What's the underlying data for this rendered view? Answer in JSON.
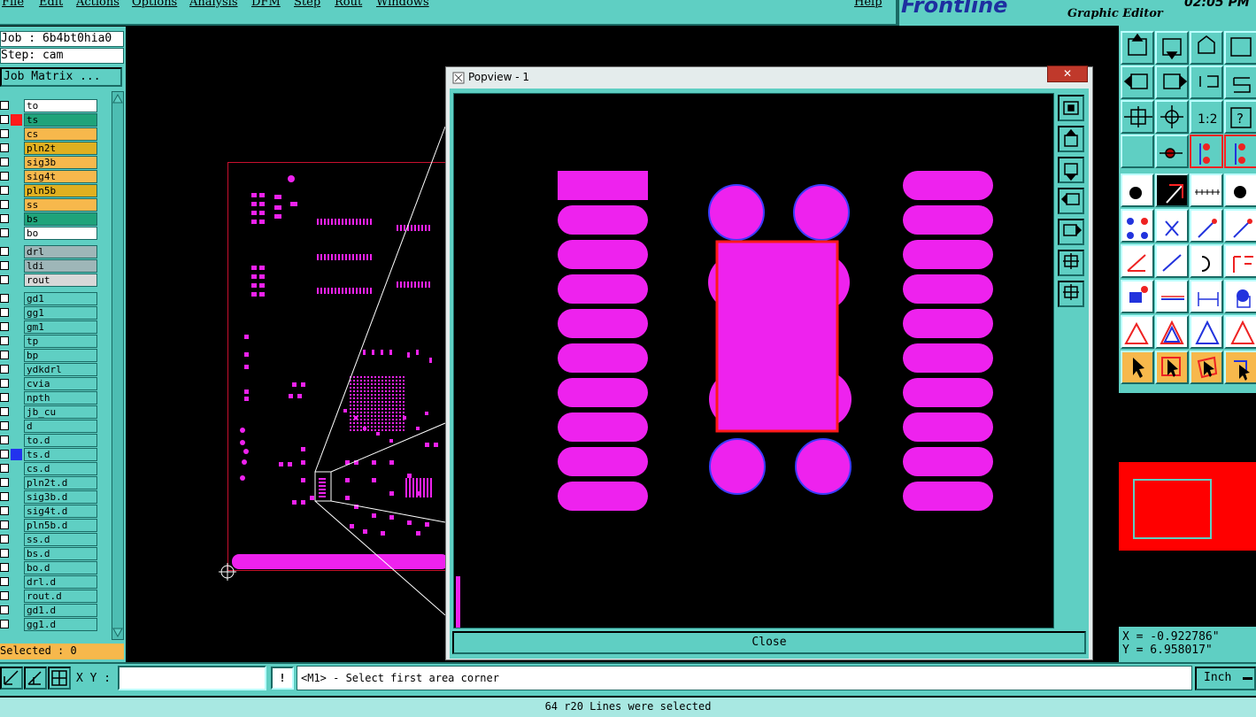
{
  "menu": {
    "items": [
      "File",
      "Edit",
      "Actions",
      "Options",
      "Analysis",
      "DFM",
      "Step",
      "Rout",
      "Windows"
    ],
    "help": "Help"
  },
  "brand": {
    "logo": "Frontline",
    "subtitle": "Graphic Editor",
    "clock": "02:05 PM"
  },
  "job": {
    "job_label": "Job : 6b4bt0hia0",
    "step_label": "Step: cam",
    "matrix_button": "Job Matrix ..."
  },
  "layers": [
    {
      "name": "to",
      "color": "#ffffff"
    },
    {
      "name": "ts",
      "color": "#1fa37a"
    },
    {
      "name": "cs",
      "color": "#f7b84c"
    },
    {
      "name": "pln2t",
      "color": "#e0b020"
    },
    {
      "name": "sig3b",
      "color": "#f7b84c"
    },
    {
      "name": "sig4t",
      "color": "#f7b84c"
    },
    {
      "name": "pln5b",
      "color": "#e0b020"
    },
    {
      "name": "ss",
      "color": "#f7b84c"
    },
    {
      "name": "bs",
      "color": "#1fa37a"
    },
    {
      "name": "bo",
      "color": "#ffffff"
    },
    {
      "name": "drl",
      "color": "#9eb6b8"
    },
    {
      "name": "ldi",
      "color": "#9eb6b8"
    },
    {
      "name": "rout",
      "color": "#d8d8d8"
    },
    {
      "name": "gd1",
      "color": "#5fcfc3"
    },
    {
      "name": "gg1",
      "color": "#5fcfc3"
    },
    {
      "name": "gm1",
      "color": "#5fcfc3"
    },
    {
      "name": "tp",
      "color": "#5fcfc3"
    },
    {
      "name": "bp",
      "color": "#5fcfc3"
    },
    {
      "name": "ydkdrl",
      "color": "#5fcfc3"
    },
    {
      "name": "cvia",
      "color": "#5fcfc3"
    },
    {
      "name": "npth",
      "color": "#5fcfc3"
    },
    {
      "name": "jb_cu",
      "color": "#5fcfc3"
    },
    {
      "name": "d",
      "color": "#5fcfc3"
    },
    {
      "name": "to.d",
      "color": "#5fcfc3"
    },
    {
      "name": "ts.d",
      "color": "#5fcfc3"
    },
    {
      "name": "cs.d",
      "color": "#5fcfc3"
    },
    {
      "name": "pln2t.d",
      "color": "#5fcfc3"
    },
    {
      "name": "sig3b.d",
      "color": "#5fcfc3"
    },
    {
      "name": "sig4t.d",
      "color": "#5fcfc3"
    },
    {
      "name": "pln5b.d",
      "color": "#5fcfc3"
    },
    {
      "name": "ss.d",
      "color": "#5fcfc3"
    },
    {
      "name": "bs.d",
      "color": "#5fcfc3"
    },
    {
      "name": "bo.d",
      "color": "#5fcfc3"
    },
    {
      "name": "drl.d",
      "color": "#5fcfc3"
    },
    {
      "name": "rout.d",
      "color": "#5fcfc3"
    },
    {
      "name": "gd1.d",
      "color": "#5fcfc3"
    },
    {
      "name": "gg1.d",
      "color": "#5fcfc3"
    }
  ],
  "selected_label": "Selected : 0",
  "popview": {
    "title": "Popview - 1",
    "close_label": "Close"
  },
  "coords": {
    "x": "X = -0.922786\"",
    "y": "Y = 6.958017\""
  },
  "bottom": {
    "xy_label": "X Y :",
    "xy_value": "",
    "bang": "!",
    "prompt": "<M1> - Select first area corner",
    "unit": "Inch",
    "status": "64 r20 Lines were selected"
  },
  "colors": {
    "accent": "#5fcfc3",
    "pad": "#ee22ee",
    "pad_outline": "#3b3bff",
    "outline_red": "#ff1a1a"
  }
}
